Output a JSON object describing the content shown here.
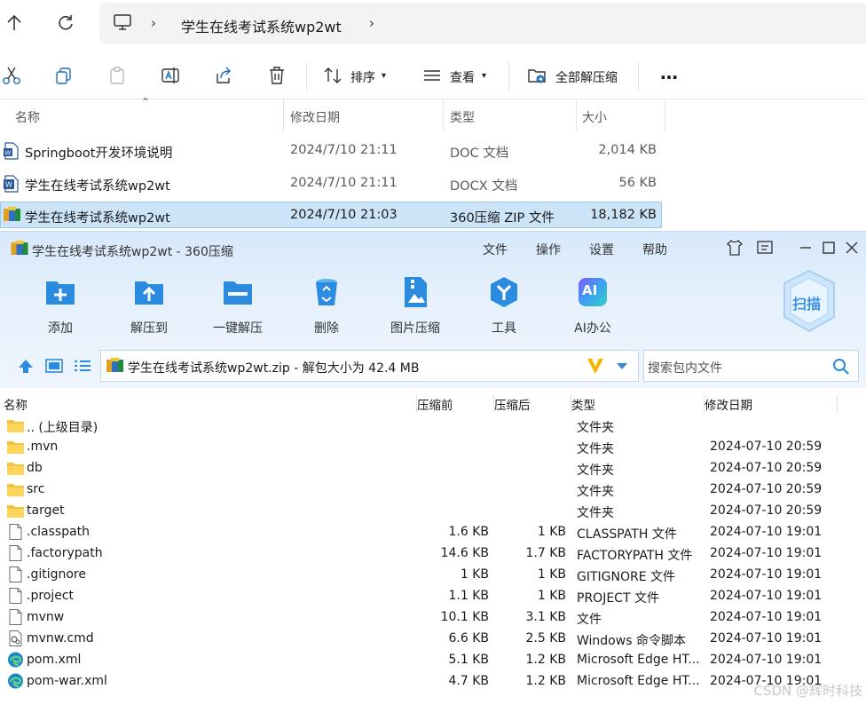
{
  "explorer": {
    "breadcrumb_folder": "学生在线考试系统wp2wt",
    "toolbar": {
      "sort_label": "排序",
      "view_label": "查看",
      "extract_all_label": "全部解压缩",
      "more_label": "…"
    },
    "columns": {
      "name": "名称",
      "date": "修改日期",
      "type": "类型",
      "size": "大小"
    },
    "files": [
      {
        "name": "Springboot开发环境说明",
        "date": "2024/7/10 21:11",
        "type": "DOC 文档",
        "size": "2,014 KB",
        "icon": "word-doc-icon"
      },
      {
        "name": "学生在线考试系统wp2wt",
        "date": "2024/7/10 21:11",
        "type": "DOCX 文档",
        "size": "56 KB",
        "icon": "word-docx-icon"
      },
      {
        "name": "学生在线考试系统wp2wt",
        "date": "2024/7/10 21:03",
        "type": "360压缩 ZIP 文件",
        "size": "18,182 KB",
        "icon": "zip-archive-icon"
      }
    ]
  },
  "zip_window": {
    "title": "学生在线考试系统wp2wt - 360压缩",
    "menu": {
      "file": "文件",
      "operate": "操作",
      "settings": "设置",
      "help": "帮助"
    },
    "tools": {
      "add": "添加",
      "extract_to": "解压到",
      "one_click_extract": "一键解压",
      "delete": "删除",
      "image_compress": "图片压缩",
      "tools": "工具",
      "ai_office": "AI办公"
    },
    "scan_label": "扫描",
    "ai_badge": "AI",
    "path_text": "学生在线考试系统wp2wt.zip - 解包大小为 42.4 MB",
    "search_placeholder": "搜索包内文件",
    "columns": {
      "name": "名称",
      "before": "压缩前",
      "after": "压缩后",
      "type": "类型",
      "date": "修改日期"
    },
    "rows": [
      {
        "name": ".. (上级目录)",
        "before": "",
        "after": "",
        "type": "文件夹",
        "date": "",
        "icon": "folder-icon"
      },
      {
        "name": ".mvn",
        "before": "",
        "after": "",
        "type": "文件夹",
        "date": "2024-07-10 20:59",
        "icon": "folder-icon"
      },
      {
        "name": "db",
        "before": "",
        "after": "",
        "type": "文件夹",
        "date": "2024-07-10 20:59",
        "icon": "folder-icon"
      },
      {
        "name": "src",
        "before": "",
        "after": "",
        "type": "文件夹",
        "date": "2024-07-10 20:59",
        "icon": "folder-icon"
      },
      {
        "name": "target",
        "before": "",
        "after": "",
        "type": "文件夹",
        "date": "2024-07-10 20:59",
        "icon": "folder-icon"
      },
      {
        "name": ".classpath",
        "before": "1.6 KB",
        "after": "1 KB",
        "type": "CLASSPATH 文件",
        "date": "2024-07-10 19:01",
        "icon": "file-icon"
      },
      {
        "name": ".factorypath",
        "before": "14.6 KB",
        "after": "1.7 KB",
        "type": "FACTORYPATH 文件",
        "date": "2024-07-10 19:01",
        "icon": "file-icon"
      },
      {
        "name": ".gitignore",
        "before": "1 KB",
        "after": "1 KB",
        "type": "GITIGNORE 文件",
        "date": "2024-07-10 19:01",
        "icon": "file-icon"
      },
      {
        "name": ".project",
        "before": "1.1 KB",
        "after": "1 KB",
        "type": "PROJECT 文件",
        "date": "2024-07-10 19:01",
        "icon": "file-icon"
      },
      {
        "name": "mvnw",
        "before": "10.1 KB",
        "after": "3.1 KB",
        "type": "文件",
        "date": "2024-07-10 19:01",
        "icon": "file-icon"
      },
      {
        "name": "mvnw.cmd",
        "before": "6.6 KB",
        "after": "2.5 KB",
        "type": "Windows 命令脚本",
        "date": "2024-07-10 19:01",
        "icon": "cmd-script-icon"
      },
      {
        "name": "pom.xml",
        "before": "5.1 KB",
        "after": "1.2 KB",
        "type": "Microsoft Edge HT...",
        "date": "2024-07-10 19:01",
        "icon": "edge-icon"
      },
      {
        "name": "pom-war.xml",
        "before": "4.7 KB",
        "after": "1.2 KB",
        "type": "Microsoft Edge HT...",
        "date": "2024-07-10 19:01",
        "icon": "edge-icon"
      }
    ]
  },
  "watermark": "CSDN @辉时科技"
}
